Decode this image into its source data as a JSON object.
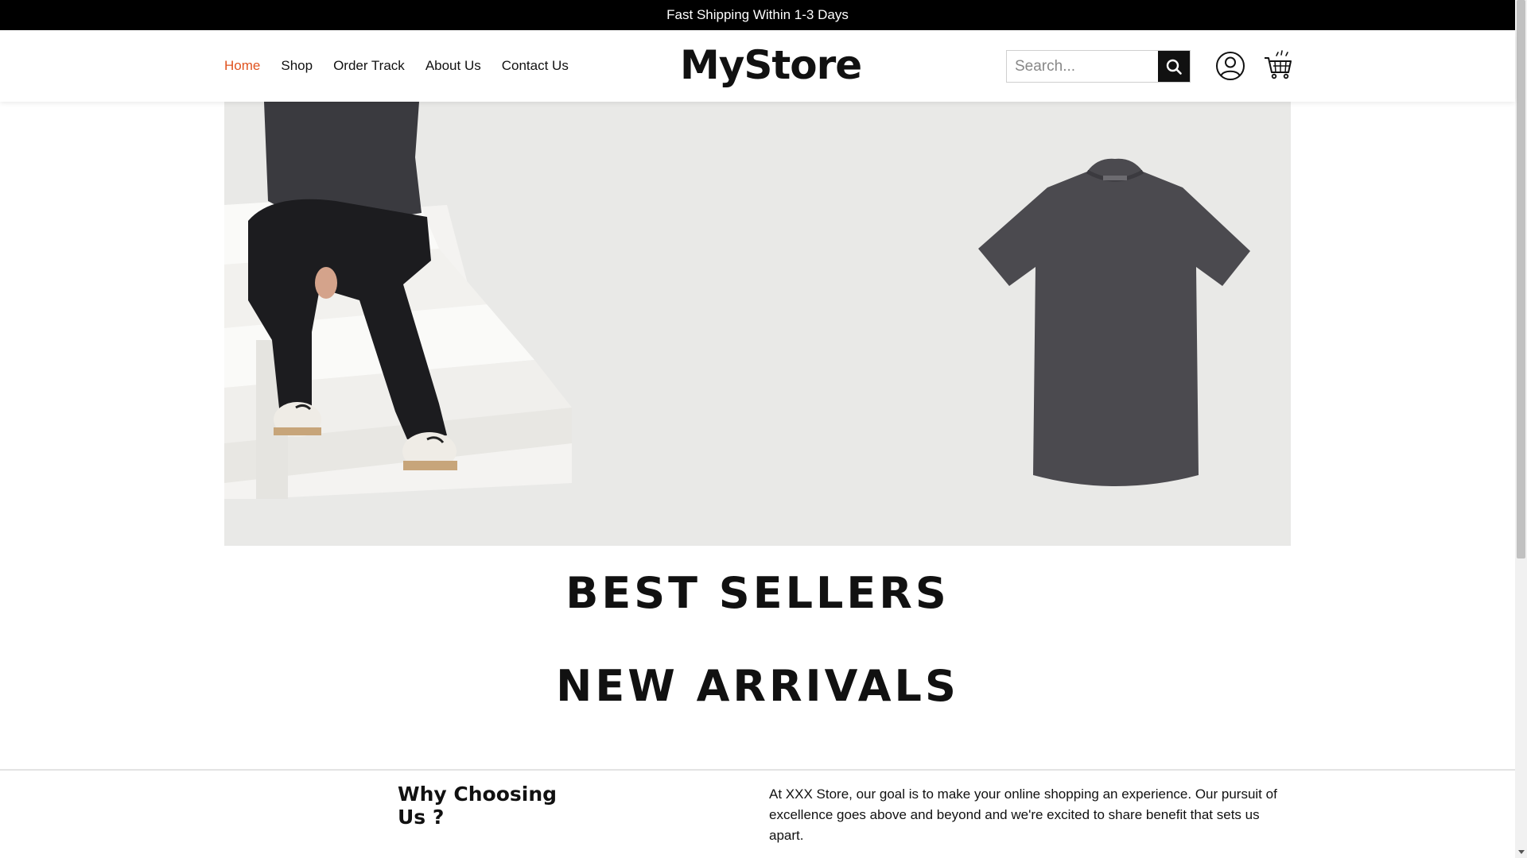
{
  "announcement": "Fast Shipping Within 1-3 Days",
  "nav": {
    "home": "Home",
    "shop": "Shop",
    "order_track": "Order Track",
    "about": "About Us",
    "contact": "Contact Us"
  },
  "logo": "MyStore",
  "search": {
    "placeholder": "Search..."
  },
  "icons": {
    "search": "search-icon",
    "user": "user-icon",
    "cart": "cart-icon"
  },
  "sections": {
    "best_sellers": "BEST SELLERS",
    "new_arrivals": "NEW ARRIVALS"
  },
  "why": {
    "title": "Why Choosing Us ?",
    "text": "At XXX Store, our goal is to make your online shopping an experience. Our pursuit of excellence goes above and beyond and we're excited to share benefit that sets us apart."
  },
  "colors": {
    "accent": "#e0531f",
    "announce_bg": "#000000",
    "hero_bg": "#e9e9e7"
  }
}
